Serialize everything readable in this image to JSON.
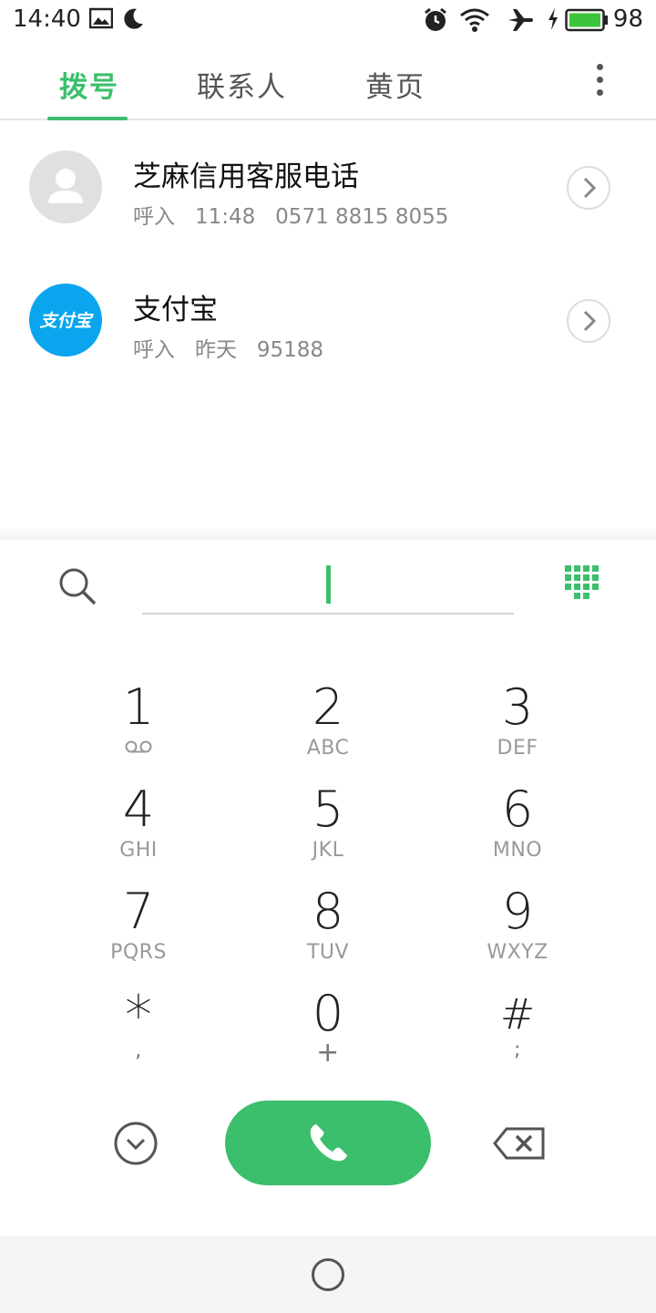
{
  "status_bar": {
    "time": "14:40",
    "battery_level": "98",
    "icons": [
      "image-icon",
      "moon-icon",
      "alarm-icon",
      "wifi-icon",
      "airplane-icon",
      "charging-icon",
      "battery-icon"
    ]
  },
  "tabs": [
    {
      "label": "拨号",
      "active": true
    },
    {
      "label": "联系人",
      "active": false
    },
    {
      "label": "黄页",
      "active": false
    }
  ],
  "call_log": [
    {
      "name": "芝麻信用客服电话",
      "type": "呼入",
      "time": "11:48",
      "number": "0571 8815 8055",
      "avatar": "default-person"
    },
    {
      "name": "支付宝",
      "type": "呼入",
      "time": "昨天",
      "number": "95188",
      "avatar": "alipay",
      "avatar_text": "支付宝"
    }
  ],
  "dialer": {
    "input_value": ""
  },
  "keypad": [
    {
      "digit": "1",
      "letters": ""
    },
    {
      "digit": "2",
      "letters": "ABC"
    },
    {
      "digit": "3",
      "letters": "DEF"
    },
    {
      "digit": "4",
      "letters": "GHI"
    },
    {
      "digit": "5",
      "letters": "JKL"
    },
    {
      "digit": "6",
      "letters": "MNO"
    },
    {
      "digit": "7",
      "letters": "PQRS"
    },
    {
      "digit": "8",
      "letters": "TUV"
    },
    {
      "digit": "9",
      "letters": "WXYZ"
    },
    {
      "digit": "*",
      "letters": ","
    },
    {
      "digit": "0",
      "letters": "+"
    },
    {
      "digit": "#",
      "letters": ";"
    }
  ],
  "colors": {
    "accent": "#3cbf6c",
    "alipay_blue": "#0aa5ee",
    "text_secondary": "#888888"
  }
}
